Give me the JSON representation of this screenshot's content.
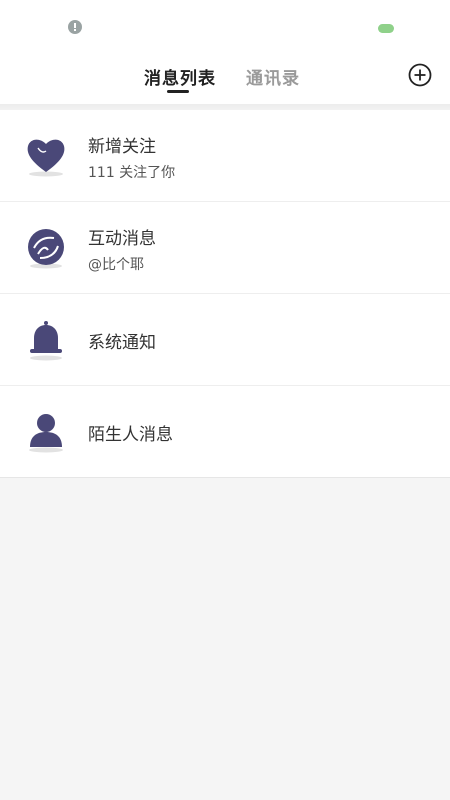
{
  "tabs": {
    "active_label": "消息列表",
    "inactive_label": "通讯录"
  },
  "messages": [
    {
      "icon": "heart-icon",
      "title": "新增关注",
      "subtitle": "111 关注了你"
    },
    {
      "icon": "interaction-icon",
      "title": "互动消息",
      "subtitle": "@比个耶"
    },
    {
      "icon": "bell-icon",
      "title": "系统通知",
      "subtitle": ""
    },
    {
      "icon": "person-icon",
      "title": "陌生人消息",
      "subtitle": ""
    }
  ],
  "colors": {
    "icon": "#4a4878",
    "accent": "#222222",
    "inactive_tab": "#9a9a9a"
  }
}
